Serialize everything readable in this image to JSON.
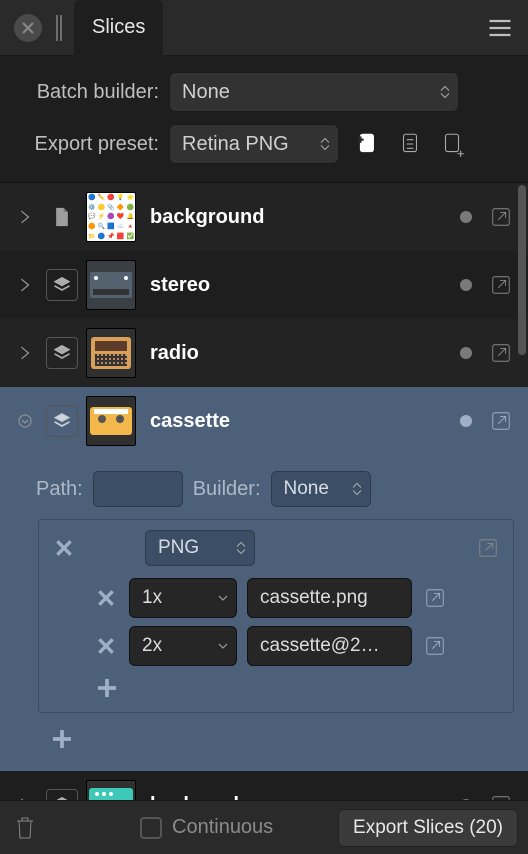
{
  "tab_title": "Slices",
  "options": {
    "batch_builder_label": "Batch builder:",
    "batch_builder_value": "None",
    "export_preset_label": "Export preset:",
    "export_preset_value": "Retina PNG"
  },
  "slices": [
    {
      "name": "background",
      "selected": false,
      "type": "page"
    },
    {
      "name": "stereo",
      "selected": false,
      "type": "layer"
    },
    {
      "name": "radio",
      "selected": false,
      "type": "layer"
    },
    {
      "name": "cassette",
      "selected": true,
      "type": "layer"
    },
    {
      "name": "keyboard",
      "selected": false,
      "type": "layer"
    }
  ],
  "selected_detail": {
    "path_label": "Path:",
    "path_value": "",
    "builder_label": "Builder:",
    "builder_value": "None",
    "format": {
      "type": "PNG",
      "scales": [
        {
          "scale": "1x",
          "filename": "cassette.png"
        },
        {
          "scale": "2x",
          "filename": "cassette@2…"
        }
      ]
    }
  },
  "footer": {
    "continuous_label": "Continuous",
    "continuous_checked": false,
    "export_button": "Export Slices (20)"
  }
}
